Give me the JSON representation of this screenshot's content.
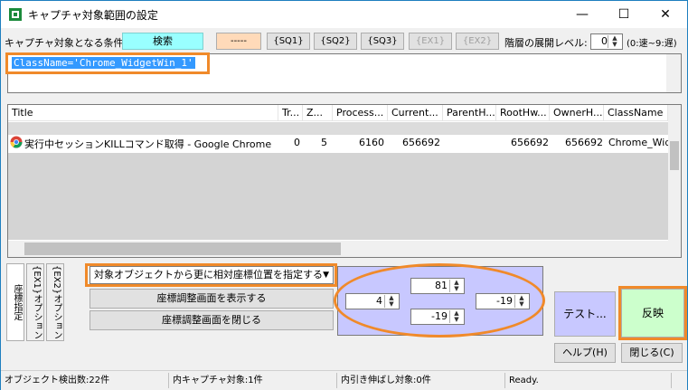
{
  "window": {
    "title": "キャプチャ対象範囲の設定",
    "minimize_glyph": "—",
    "maximize_glyph": "☐",
    "close_glyph": "✕"
  },
  "condition_bar": {
    "label": "キャプチャ対象となる条件:",
    "search_button": "検索",
    "dash_button": "-----",
    "sq_buttons": [
      "{SQ1}",
      "{SQ2}",
      "{SQ3}"
    ],
    "ex_buttons": [
      "{EX1}",
      "{EX2}"
    ],
    "depth_label": "階層の展開レベル:",
    "depth_value": "0",
    "depth_hint": "(0:速~9:遅)"
  },
  "filter": {
    "value": "ClassName='Chrome_WidgetWin_1'"
  },
  "table": {
    "columns": [
      "Title",
      "Tr...",
      "Z...",
      "Process...",
      "Current...",
      "ParentH...",
      "RootHw...",
      "OwnerH...",
      "ClassName"
    ],
    "highlighted_row": {
      "title": "実行中セッションKILLコマンド取得 - Google Chrome",
      "tr": "0",
      "z": "5",
      "process": "6160",
      "current": "656692",
      "parent": "",
      "root": "656692",
      "owner": "656692",
      "classname": "Chrome_Widge"
    }
  },
  "side_tabs": [
    "座標指定",
    "{EX1}オプション",
    "{EX2}オプション"
  ],
  "coord": {
    "mode_select": "対象オブジェクトから更に相対座標位置を指定する",
    "show_button": "座標調整画面を表示する",
    "close_button": "座標調整画面を閉じる",
    "top": "81",
    "left": "4",
    "right": "-19",
    "bottom": "-19"
  },
  "actions": {
    "test": "テスト...",
    "apply": "反映",
    "help": "ヘルプ(H)",
    "close": "閉じる(C)"
  },
  "status": {
    "detected": "オブジェクト検出数:22件",
    "capture_targets": "内キャプチャ対象:1件",
    "stretch_targets": "内引き伸ばし対象:0件",
    "state": "Ready."
  },
  "colors": {
    "search_button": "#99ffff",
    "dash_button": "#ffdab9",
    "highlight": "#f08a2a",
    "panel": "#c8c8ff",
    "test_button": "#c8c8ff",
    "apply_button": "#ccffcc"
  }
}
